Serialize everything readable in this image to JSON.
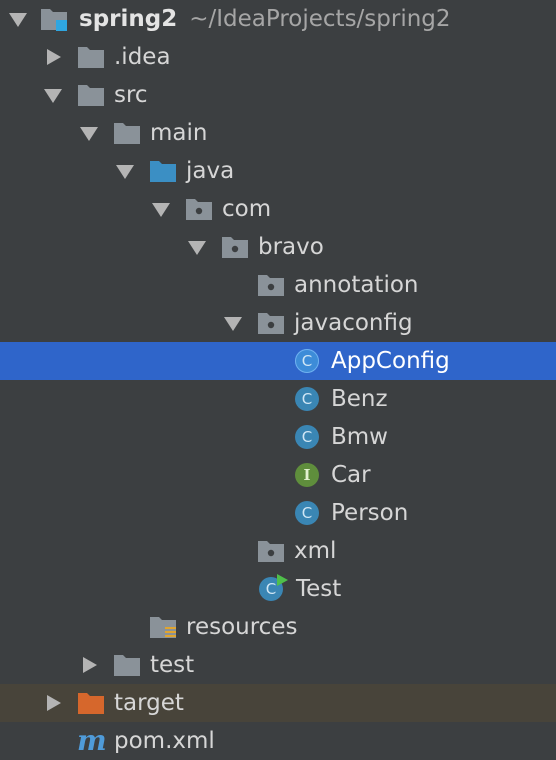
{
  "project": {
    "name": "spring2",
    "path": "~/IdeaProjects/spring2"
  },
  "tree": {
    "idea": ".idea",
    "src": "src",
    "main": "main",
    "java": "java",
    "com": "com",
    "bravo": "bravo",
    "annotation": "annotation",
    "javaconfig": "javaconfig",
    "classes": [
      {
        "name": "AppConfig",
        "kind": "class",
        "icon": "class-icon",
        "selected": true
      },
      {
        "name": "Benz",
        "kind": "class",
        "icon": "class-icon"
      },
      {
        "name": "Bmw",
        "kind": "class",
        "icon": "class-icon"
      },
      {
        "name": "Car",
        "kind": "interface",
        "icon": "interface-icon"
      },
      {
        "name": "Person",
        "kind": "class",
        "icon": "class-icon"
      }
    ],
    "xml": "xml",
    "test_class": "Test",
    "resources": "resources",
    "test": "test",
    "target": "target",
    "pom": "pom.xml"
  },
  "icon_glyphs": {
    "class": "C",
    "interface": "I",
    "maven": "m"
  },
  "colors": {
    "background": "#3c3f41",
    "selection": "#2f65ca",
    "excluded_row": "#48443a",
    "folder": "#8a9299",
    "source_folder": "#3b8fc4",
    "excluded_folder": "#d6672c",
    "class_icon": "#3a86b4",
    "interface_icon": "#5f8e3c"
  }
}
